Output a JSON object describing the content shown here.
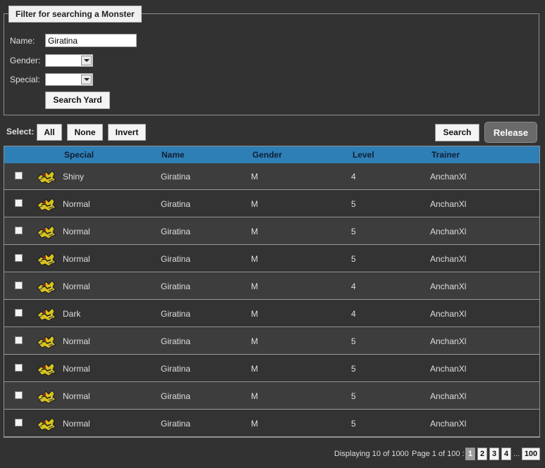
{
  "filter": {
    "legend": "Filter for searching a Monster",
    "name_label": "Name:",
    "name_value": "Giratina",
    "gender_label": "Gender:",
    "special_label": "Special:",
    "search_yard_label": "Search Yard"
  },
  "select_bar": {
    "label": "Select:",
    "all_label": "All",
    "none_label": "None",
    "invert_label": "Invert",
    "search_label": "Search",
    "release_label": "Release"
  },
  "table": {
    "headers": {
      "special": "Special",
      "name": "Name",
      "gender": "Gender",
      "level": "Level",
      "trainer": "Trainer"
    },
    "rows": [
      {
        "special": "Shiny",
        "name": "Giratina",
        "gender": "M",
        "level": "4",
        "trainer": "AnchanXl"
      },
      {
        "special": "Normal",
        "name": "Giratina",
        "gender": "M",
        "level": "5",
        "trainer": "AnchanXl"
      },
      {
        "special": "Normal",
        "name": "Giratina",
        "gender": "M",
        "level": "5",
        "trainer": "AnchanXl"
      },
      {
        "special": "Normal",
        "name": "Giratina",
        "gender": "M",
        "level": "5",
        "trainer": "AnchanXl"
      },
      {
        "special": "Normal",
        "name": "Giratina",
        "gender": "M",
        "level": "4",
        "trainer": "AnchanXl"
      },
      {
        "special": "Dark",
        "name": "Giratina",
        "gender": "M",
        "level": "4",
        "trainer": "AnchanXl"
      },
      {
        "special": "Normal",
        "name": "Giratina",
        "gender": "M",
        "level": "5",
        "trainer": "AnchanXl"
      },
      {
        "special": "Normal",
        "name": "Giratina",
        "gender": "M",
        "level": "5",
        "trainer": "AnchanXl"
      },
      {
        "special": "Normal",
        "name": "Giratina",
        "gender": "M",
        "level": "5",
        "trainer": "AnchanXl"
      },
      {
        "special": "Normal",
        "name": "Giratina",
        "gender": "M",
        "level": "5",
        "trainer": "AnchanXl"
      }
    ]
  },
  "footer": {
    "displaying": "Displaying 10 of 1000",
    "page_info": "Page 1 of 100 :",
    "pages": [
      "1",
      "2",
      "3",
      "4"
    ],
    "ellipsis": "...",
    "last_page": "100",
    "current_page": "1"
  },
  "colors": {
    "header_bg": "#2f7fb7",
    "background": "#323232"
  },
  "icons": {
    "row_sprite": "giratina-sprite-icon",
    "checkbox": "checkbox-icon",
    "dropdown": "chevron-down-icon"
  }
}
